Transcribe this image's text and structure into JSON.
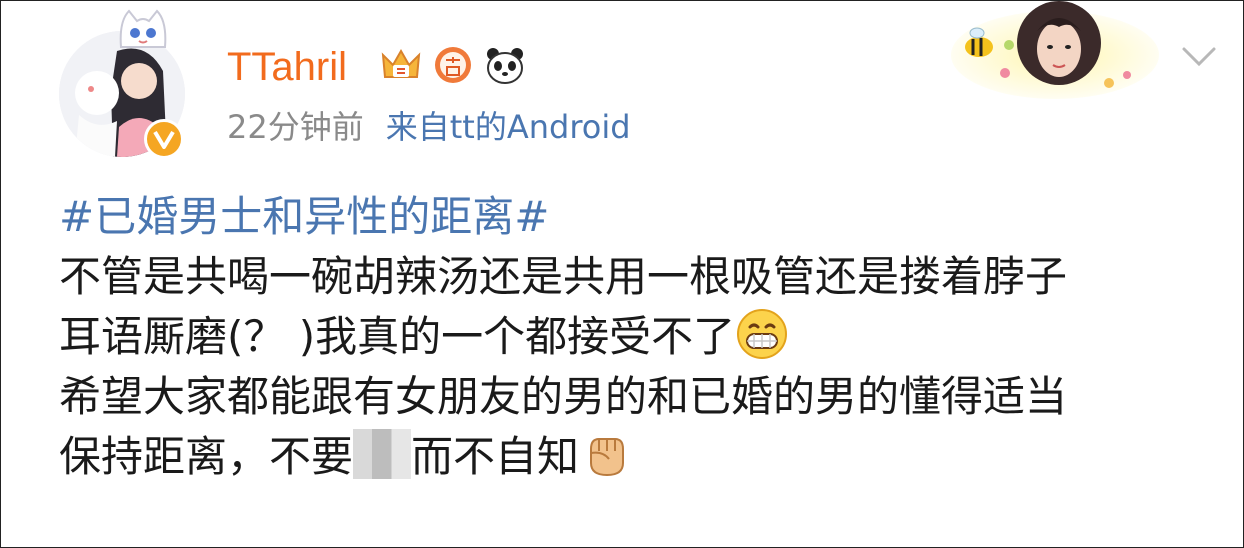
{
  "post": {
    "username": "TTahril",
    "time": "22分钟前",
    "source": "来自tt的Android",
    "topic": "#已婚男士和异性的距离#",
    "lines": [
      "不管是共喝一碗胡辣汤还是共用一根吸管还是搂着脖子",
      "耳语厮磨(？ )我真的一个都接受不了",
      "希望大家都能跟有女朋友的男的和已婚的男的懂得适当",
      "保持距离，不要",
      "而不自知"
    ]
  },
  "icons": {
    "vip": "verified-v-icon",
    "crown": "crown-level-icon",
    "answer_badge": "answer-badge-icon",
    "panda": "panda-icon",
    "more": "chevron-down-icon",
    "emoji_grin": "grin-emoji-icon",
    "emoji_fist": "fist-emoji-icon",
    "mosaic": "censor-mosaic"
  },
  "colors": {
    "username": "#f26b1d",
    "link": "#4a76b0",
    "meta": "#8a8a8a",
    "vip": "#f5a623"
  }
}
